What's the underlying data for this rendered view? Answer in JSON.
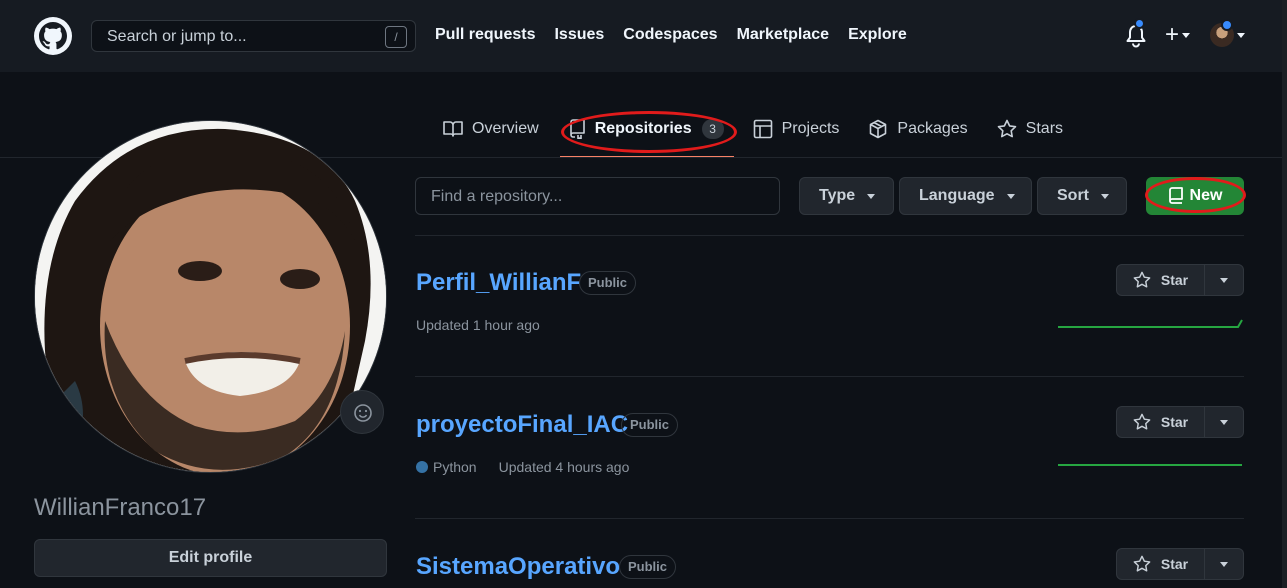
{
  "header": {
    "search_placeholder": "Search or jump to...",
    "search_shortcut": "/",
    "nav": [
      "Pull requests",
      "Issues",
      "Codespaces",
      "Marketplace",
      "Explore"
    ]
  },
  "tabs": [
    {
      "label": "Overview",
      "icon": "book-icon"
    },
    {
      "label": "Repositories",
      "icon": "repo-icon",
      "count": "3",
      "active": true
    },
    {
      "label": "Projects",
      "icon": "table-icon"
    },
    {
      "label": "Packages",
      "icon": "package-icon"
    },
    {
      "label": "Stars",
      "icon": "star-icon"
    }
  ],
  "profile": {
    "username": "WillianFranco17",
    "edit_label": "Edit profile"
  },
  "toolbar": {
    "find_placeholder": "Find a repository...",
    "type_label": "Type",
    "language_label": "Language",
    "sort_label": "Sort",
    "new_label": "New"
  },
  "repos": [
    {
      "name": "Perfil_WillianF",
      "visibility": "Public",
      "language": "",
      "updated": "Updated 1 hour ago",
      "star_label": "Star"
    },
    {
      "name": "proyectoFinal_IAC",
      "visibility": "Public",
      "language": "Python",
      "updated": "Updated 4 hours ago",
      "star_label": "Star"
    },
    {
      "name": "SistemaOperativo",
      "visibility": "Public",
      "language": "",
      "updated": "",
      "star_label": "Star"
    }
  ],
  "colors": {
    "accent_green": "#238636",
    "link_blue": "#58a6ff",
    "highlight_red": "#e11b1b",
    "python": "#3572a5"
  }
}
